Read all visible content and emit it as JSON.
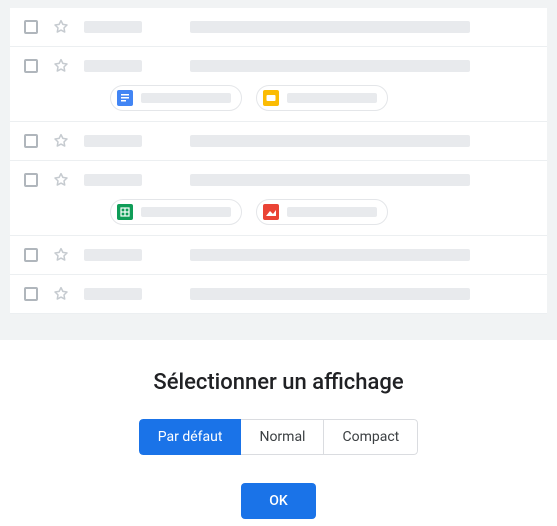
{
  "title": "Sélectionner un affichage",
  "options": {
    "default": "Par défaut",
    "comfortable": "Normal",
    "compact": "Compact"
  },
  "selected": "default",
  "ok_label": "OK",
  "icons": {
    "docs": "#4285f4",
    "slides": "#fbbc04",
    "sheets": "#0f9d58",
    "image": "#ea4335"
  },
  "rows": [
    {
      "chips": []
    },
    {
      "chips": [
        "docs",
        "slides"
      ]
    },
    {
      "chips": []
    },
    {
      "chips": [
        "sheets",
        "image"
      ]
    },
    {
      "chips": []
    },
    {
      "chips": []
    }
  ]
}
